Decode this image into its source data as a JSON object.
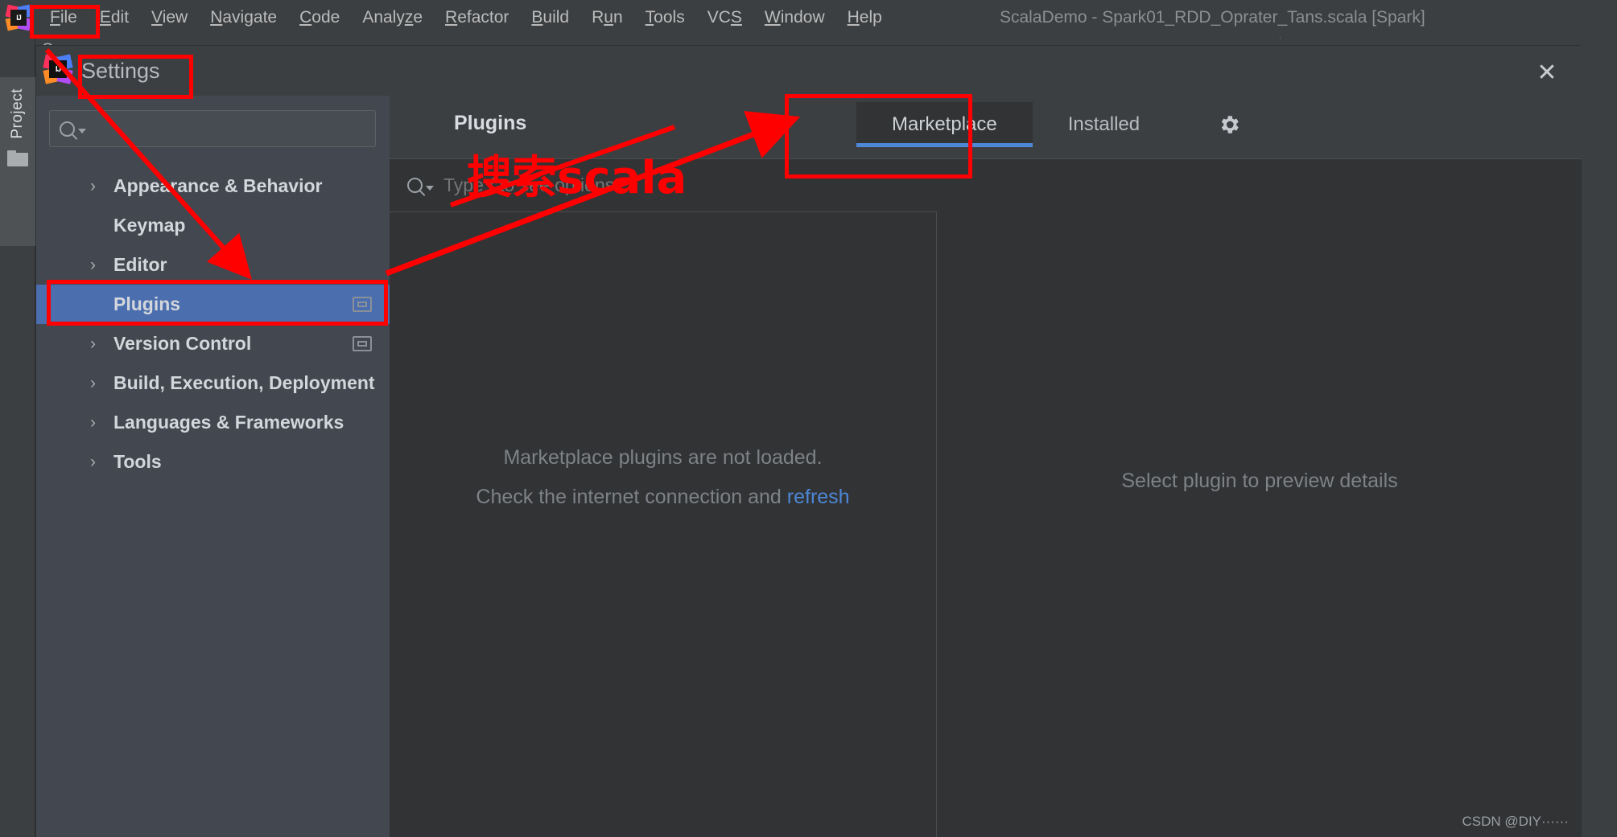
{
  "window": {
    "title": "ScalaDemo - Spark01_RDD_Oprater_Tans.scala [Spark]",
    "logo_text": "IJ"
  },
  "menubar": {
    "items": [
      {
        "label": "File",
        "mnemonic": "F"
      },
      {
        "label": "Edit",
        "mnemonic": "E"
      },
      {
        "label": "View",
        "mnemonic": "V"
      },
      {
        "label": "Navigate",
        "mnemonic": "N"
      },
      {
        "label": "Code",
        "mnemonic": "C"
      },
      {
        "label": "Analyze",
        "mnemonic": "z"
      },
      {
        "label": "Refactor",
        "mnemonic": "R"
      },
      {
        "label": "Build",
        "mnemonic": "B"
      },
      {
        "label": "Run",
        "mnemonic": "u"
      },
      {
        "label": "Tools",
        "mnemonic": "T"
      },
      {
        "label": "VCS",
        "mnemonic": "S"
      },
      {
        "label": "Window",
        "mnemonic": "W"
      },
      {
        "label": "Help",
        "mnemonic": "H"
      }
    ]
  },
  "toolwindow": {
    "project_label": "Project",
    "editor_tab_label": "Sc"
  },
  "dialog": {
    "title": "Settings",
    "close_label": "✕",
    "search": {
      "value": "",
      "placeholder": ""
    },
    "tree": [
      {
        "label": "Appearance & Behavior",
        "expandable": true,
        "selected": false,
        "badge": false
      },
      {
        "label": "Keymap",
        "expandable": false,
        "selected": false,
        "badge": false
      },
      {
        "label": "Editor",
        "expandable": true,
        "selected": false,
        "badge": false
      },
      {
        "label": "Plugins",
        "expandable": false,
        "selected": true,
        "badge": true
      },
      {
        "label": "Version Control",
        "expandable": true,
        "selected": false,
        "badge": true
      },
      {
        "label": "Build, Execution, Deployment",
        "expandable": true,
        "selected": false,
        "badge": false
      },
      {
        "label": "Languages & Frameworks",
        "expandable": true,
        "selected": false,
        "badge": false
      },
      {
        "label": "Tools",
        "expandable": true,
        "selected": false,
        "badge": false
      }
    ]
  },
  "plugins": {
    "page_title": "Plugins",
    "tabs": [
      {
        "label": "Marketplace",
        "active": true
      },
      {
        "label": "Installed",
        "active": false
      }
    ],
    "gear_icon": "gear-icon",
    "search": {
      "value": "",
      "placeholder": "Type / to see options"
    },
    "empty_state": {
      "line1": "Marketplace plugins are not loaded.",
      "line2_prefix": "Check the internet connection and ",
      "line2_link": "refresh"
    },
    "detail_placeholder": "Select plugin to preview details"
  },
  "annotations": {
    "chinese_note": "搜索scala",
    "color": "#fe0000"
  },
  "watermark": "CSDN @DIY······",
  "colors": {
    "accent_blue": "#4b6eaf",
    "tab_underline": "#4e87d6",
    "link": "#4e87d6",
    "annotation_red": "#fe0000",
    "dialog_bg": "#3c3f41",
    "tree_bg": "#434750",
    "content_bg": "#313335"
  }
}
